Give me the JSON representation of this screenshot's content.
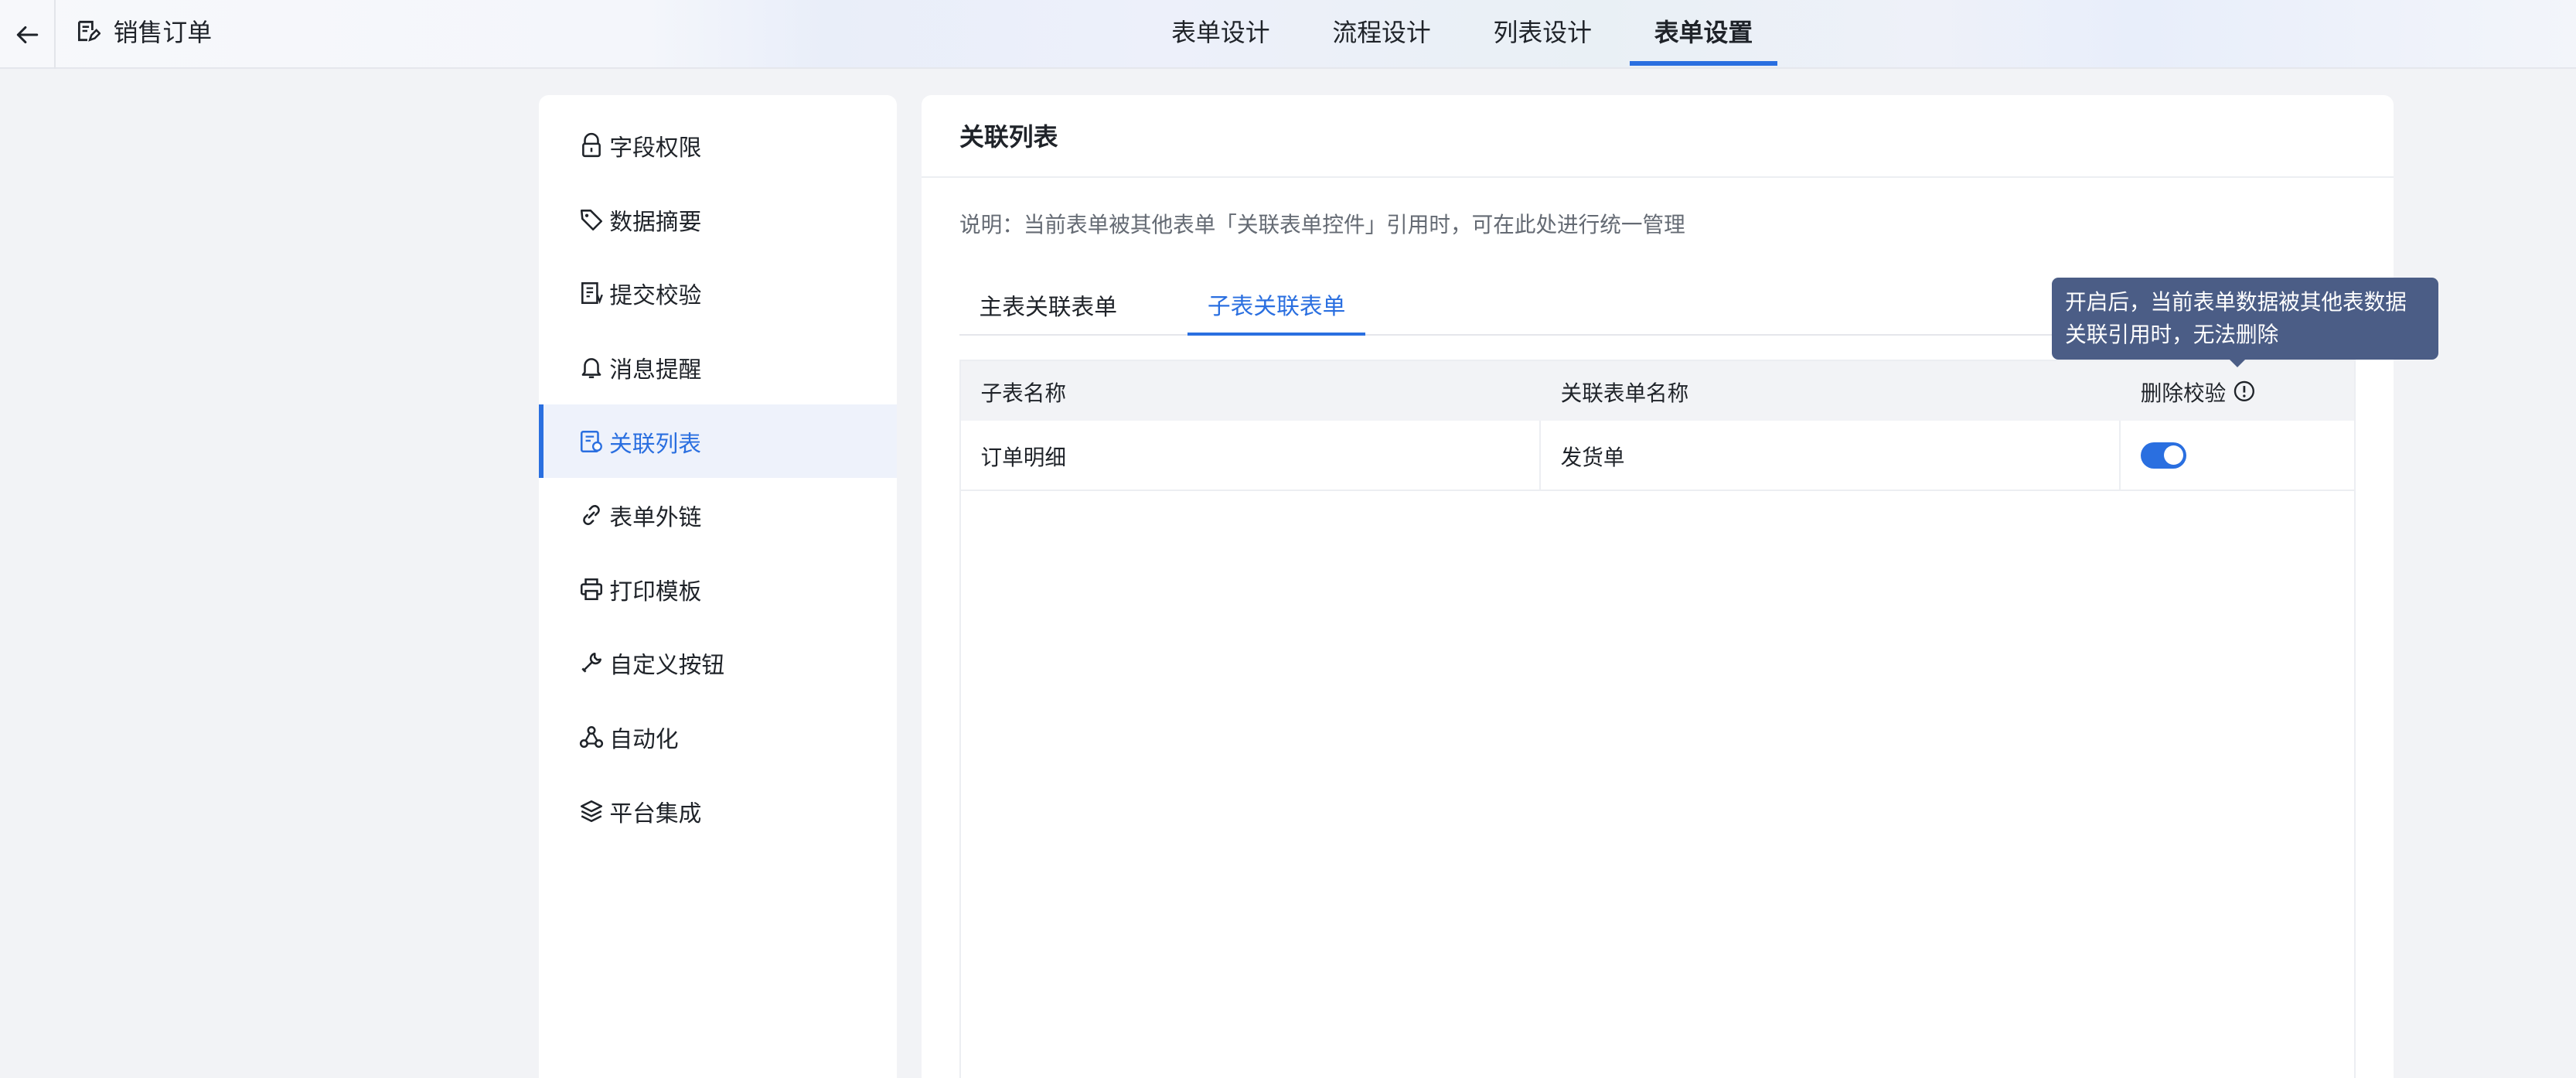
{
  "header": {
    "back_icon": "arrow-left-icon",
    "app_icon": "form-edit-icon",
    "title": "销售订单",
    "tabs": [
      {
        "label": "表单设计",
        "active": false
      },
      {
        "label": "流程设计",
        "active": false
      },
      {
        "label": "列表设计",
        "active": false
      },
      {
        "label": "表单设置",
        "active": true
      }
    ]
  },
  "sidebar": {
    "items": [
      {
        "label": "字段权限",
        "icon": "lock-icon",
        "active": false
      },
      {
        "label": "数据摘要",
        "icon": "tag-icon",
        "active": false
      },
      {
        "label": "提交校验",
        "icon": "checklist-icon",
        "active": false
      },
      {
        "label": "消息提醒",
        "icon": "bell-icon",
        "active": false
      },
      {
        "label": "关联列表",
        "icon": "linked-list-icon",
        "active": true
      },
      {
        "label": "表单外链",
        "icon": "link-icon",
        "active": false
      },
      {
        "label": "打印模板",
        "icon": "printer-icon",
        "active": false
      },
      {
        "label": "自定义按钮",
        "icon": "wrench-icon",
        "active": false
      },
      {
        "label": "自动化",
        "icon": "automation-icon",
        "active": false
      },
      {
        "label": "平台集成",
        "icon": "layers-icon",
        "active": false
      }
    ]
  },
  "main": {
    "title": "关联列表",
    "description": "说明：当前表单被其他表单「关联表单控件」引用时，可在此处进行统一管理",
    "tabs": [
      {
        "label": "主表关联表单",
        "active": false
      },
      {
        "label": "子表关联表单",
        "active": true
      }
    ],
    "table": {
      "columns": [
        "子表名称",
        "关联表单名称",
        "删除校验"
      ],
      "rows": [
        {
          "sub_table": "订单明细",
          "linked_form": "发货单",
          "delete_check": true
        }
      ]
    },
    "tooltip": "开启后，当前表单数据被其他表数据关联引用时，无法删除"
  },
  "colors": {
    "accent": "#2a6fe0",
    "tooltip_bg": "#4b5d86"
  }
}
